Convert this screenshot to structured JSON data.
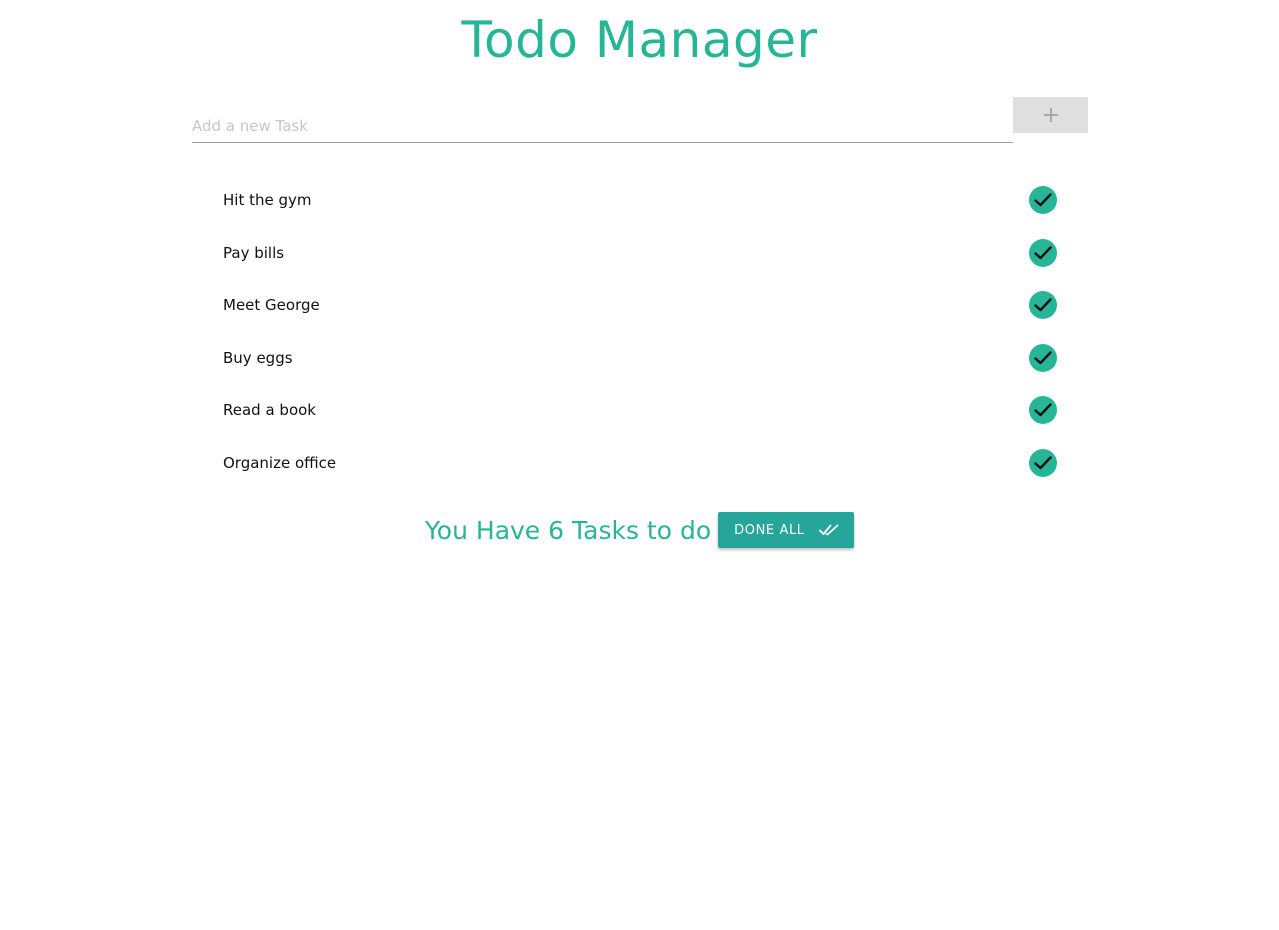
{
  "header": {
    "title": "Todo Manager"
  },
  "add_task": {
    "placeholder": "Add a new Task",
    "value": "",
    "button_icon": "plus-icon"
  },
  "tasks": [
    {
      "label": "Hit the gym",
      "action_icon": "check-icon"
    },
    {
      "label": "Pay bills",
      "action_icon": "check-icon"
    },
    {
      "label": "Meet George",
      "action_icon": "check-icon"
    },
    {
      "label": "Buy eggs",
      "action_icon": "check-icon"
    },
    {
      "label": "Read a book",
      "action_icon": "check-icon"
    },
    {
      "label": "Organize office",
      "action_icon": "check-icon"
    }
  ],
  "footer": {
    "count_prefix": "You Have ",
    "count": "6",
    "count_suffix": " Tasks to do",
    "done_all_label": "DONE ALL",
    "done_all_icon": "double-check-icon"
  },
  "colors": {
    "accent": "#26b597",
    "button": "#26a69a",
    "add_button_bg": "#dfdfdf"
  }
}
